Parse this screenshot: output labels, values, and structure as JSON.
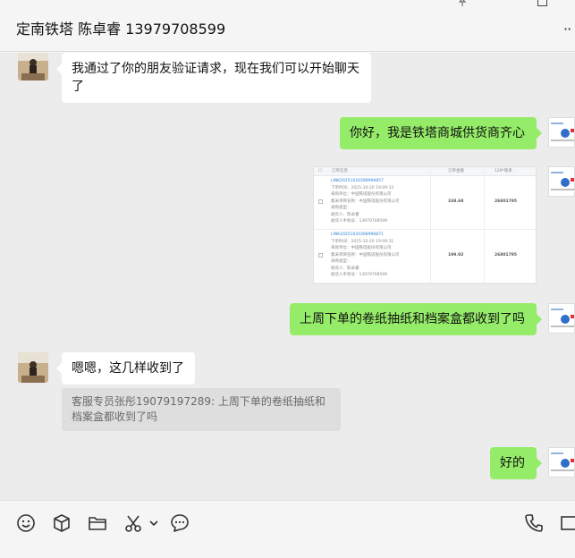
{
  "header": {
    "title": "定南铁塔 陈卓睿 13979708599",
    "more": "··"
  },
  "messages": {
    "m1": "我通过了你的朋友验证请求，现在我们可以开始聊天了",
    "m2": "你好，我是铁塔商城供货商齐心",
    "m3": "上周下单的卷纸抽纸和档案盒都收到了吗",
    "m4": "嗯嗯，这几样收到了",
    "quote": "客服专员张彤19079197289: 上周下单的卷纸抽纸和档案盒都收到了吗",
    "m5": "好的"
  },
  "order_screenshot": {
    "col_info": "订单信息",
    "col_amount": "订单金额",
    "col_phone": "129*联系",
    "orders": [
      {
        "id": "LINK20251020398996857",
        "time": "下单时间：2025-10-20 19:09:33",
        "buyer": "采购单位：中国铁塔股份有限公司",
        "project": "集采项目名称：中国铁塔股份有限公司",
        "type": "采购类型：",
        "receiver": "收货人：陈卓睿",
        "phone": "收货人手机号：13979708599",
        "amount": "338.68",
        "contact": "26801795"
      },
      {
        "id": "LINK20251020398996871",
        "time": "下单时间：2025-10-20 19:09:31",
        "buyer": "采购单位：中国铁塔股份有限公司",
        "project": "集采项目名称：中国铁塔股份有限公司",
        "type": "采购类型：",
        "receiver": "收货人：陈卓睿",
        "phone": "收货人手机号：13979708599",
        "amount": "199.92",
        "contact": "26801795"
      }
    ]
  },
  "icons": [
    "emoji-icon",
    "package-icon",
    "folder-icon",
    "scissors-icon",
    "chevron-down-icon",
    "chat-bubble-icon",
    "phone-icon",
    "screen-icon",
    "pin-icon",
    "maximize-icon"
  ],
  "colors": {
    "bubble_right": "#95ec69",
    "bubble_left": "#ffffff",
    "chat_bg": "#ececec"
  }
}
